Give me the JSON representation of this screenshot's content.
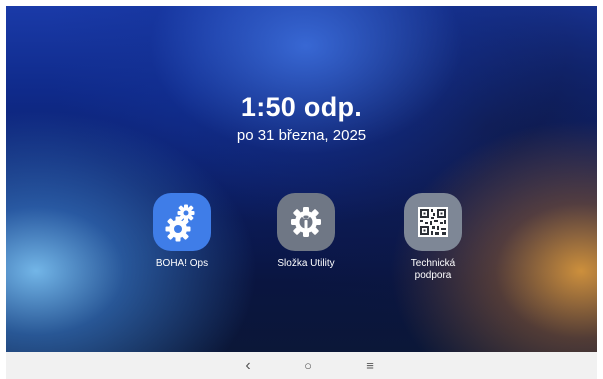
{
  "clock": {
    "time": "1:50 odp.",
    "date": "po 31 března, 2025"
  },
  "apps": [
    {
      "label": "BOHA! Ops",
      "icon": "gears-icon",
      "color": "#3f7de8"
    },
    {
      "label": "Složka Utility",
      "icon": "gear-wrench-icon",
      "color": "#6f7785"
    },
    {
      "label_line1": "Technická",
      "label_line2": "podpora",
      "icon": "qr-code-icon",
      "color": "#7e8796"
    }
  ],
  "navbar": {
    "back": "‹",
    "home": "○",
    "recents": "≡"
  }
}
